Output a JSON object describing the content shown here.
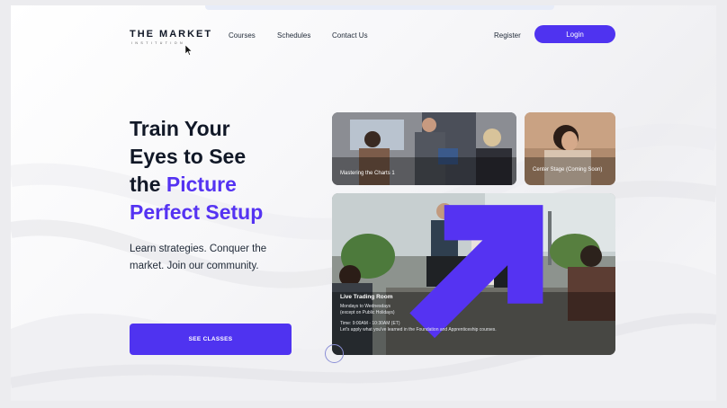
{
  "header": {
    "logo_text": "THE MARKET",
    "logo_subtext": "INSTITUTION",
    "nav": [
      "Courses",
      "Schedules",
      "Contact Us"
    ],
    "register_label": "Register",
    "login_label": "Login"
  },
  "hero": {
    "title_line1": "Train Your",
    "title_line2": "Eyes to See",
    "title_line3_plain": "the ",
    "title_line3_accent": "Picture",
    "title_line4_accent": "Perfect Setup",
    "subtitle": "Learn strategies. Conquer the market. Join our community.",
    "cta_label": "SEE CLASSES"
  },
  "cards": {
    "card1_caption": "Mastering the Charts 1",
    "card2_caption": "Center Stage (Coming Soon)",
    "card3": {
      "title": "Live Trading Room",
      "days": "Mondays to Wednesdays",
      "note": "(except on Public Holidays)",
      "time": "Time: 9:00AM - 10:30AM (ET)",
      "description": "Let's apply what you've learned in the Foundation and Apprenticeship courses."
    }
  },
  "colors": {
    "accent": "#4f33f0",
    "accent_text": "#5533f2",
    "heading": "#111827"
  },
  "icons": {
    "card3_corner": "arrow-up-right-icon",
    "carousel_indicator": "circle-icon",
    "pointer": "mouse-cursor-icon"
  }
}
